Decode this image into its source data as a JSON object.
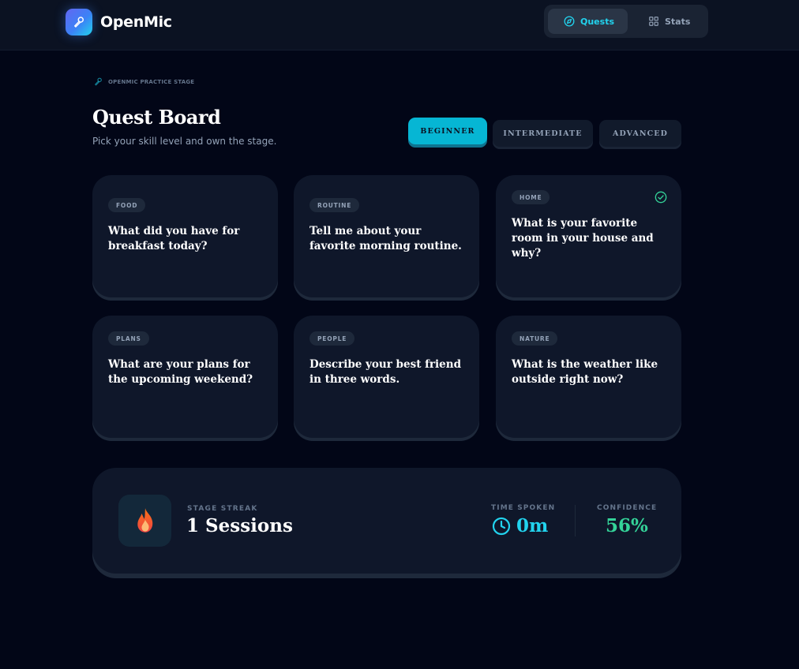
{
  "header": {
    "brand": "OpenMic",
    "nav": [
      {
        "label": "Quests",
        "icon": "compass-icon",
        "active": true
      },
      {
        "label": "Stats",
        "icon": "grid-icon",
        "active": false
      }
    ]
  },
  "page": {
    "eyebrow": "OPENMIC PRACTICE STAGE",
    "title": "Quest Board",
    "subtitle": "Pick your skill level and own the stage.",
    "levels": [
      {
        "label": "BEGINNER",
        "active": true
      },
      {
        "label": "INTERMEDIATE",
        "active": false
      },
      {
        "label": "ADVANCED",
        "active": false
      }
    ]
  },
  "quests": [
    {
      "tag": "FOOD",
      "question": "What did you have for breakfast today?",
      "completed": false
    },
    {
      "tag": "ROUTINE",
      "question": "Tell me about your favorite morning routine.",
      "completed": false
    },
    {
      "tag": "HOME",
      "question": "What is your favorite room in your house and why?",
      "completed": true
    },
    {
      "tag": "PLANS",
      "question": "What are your plans for the upcoming weekend?",
      "completed": false
    },
    {
      "tag": "PEOPLE",
      "question": "Describe your best friend in three words.",
      "completed": false
    },
    {
      "tag": "NATURE",
      "question": "What is the weather like outside right now?",
      "completed": false
    }
  ],
  "stats": {
    "streak_label": "STAGE STREAK",
    "streak_value": "1 Sessions",
    "time_label": "TIME SPOKEN",
    "time_value": "0m",
    "confidence_label": "CONFIDENCE",
    "confidence_value": "56%"
  },
  "colors": {
    "accent": "#06b6d4",
    "accent_text": "#22d3ee",
    "success": "#34d399",
    "background": "#020617",
    "card": "#0f172a"
  }
}
